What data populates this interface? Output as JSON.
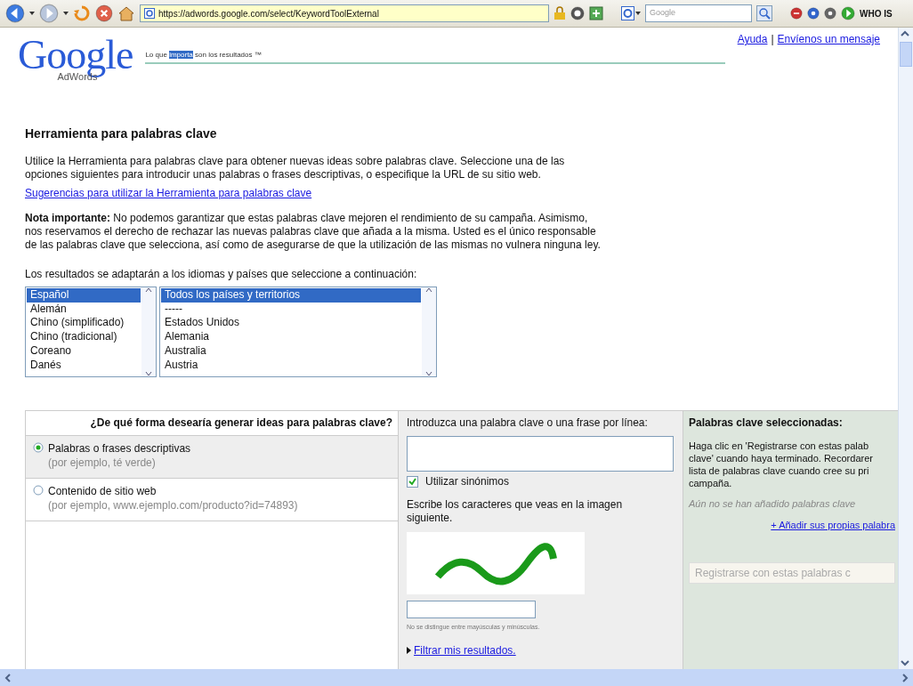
{
  "browser": {
    "url": "https://adwords.google.com/select/KeywordToolExternal",
    "search_placeholder": "Google",
    "whois": "WHO IS"
  },
  "header": {
    "logo": "Google",
    "logo_sub": "AdWords",
    "tagline": {
      "before": "Lo que ",
      "selected_text": "importa",
      "after": " son los resultados ™"
    },
    "links": [
      "Ayuda",
      "Envíenos un mensaje"
    ],
    "separator": "|"
  },
  "title": "Herramienta para palabras clave",
  "intro": "Utilice la Herramienta para palabras clave para obtener nuevas ideas sobre palabras clave. Seleccione una de las opciones siguientes para introducir unas palabras o frases descriptivas, o especifique la URL de su sitio web.",
  "tips_link": "Sugerencias para utilizar la Herramienta para palabras clave",
  "note": "**Nota importante:** No podemos garantizar que estas palabras clave mejoren el rendimiento de su campaña. Asimismo, nos reservamos el derecho de rechazar las nuevas palabras clave que añada a la misma. Usted es el único responsable de las palabras clave que selecciona, así como de asegurarse de que la utilización de las mismas no vulnera ninguna ley.",
  "lists_label": "Los resultados se adaptarán a los idiomas y países que seleccione a continuación:",
  "languages": [
    {
      "label": "Español",
      "selected": true
    },
    {
      "label": "Alemán",
      "selected": false
    },
    {
      "label": "Chino (simplificado)",
      "selected": false
    },
    {
      "label": "Chino (tradicional)",
      "selected": false
    },
    {
      "label": "Coreano",
      "selected": false
    },
    {
      "label": "Danés",
      "selected": false
    }
  ],
  "countries": [
    {
      "label": "Todos los países y territorios",
      "selected": true
    },
    {
      "label": "-----",
      "selected": false
    },
    {
      "label": "Estados Unidos",
      "selected": false
    },
    {
      "label": "Alemania",
      "selected": false
    },
    {
      "label": "Australia",
      "selected": false
    },
    {
      "label": "Austria",
      "selected": false
    }
  ],
  "method": {
    "heading": "¿De qué forma desearía generar ideas para palabras clave?",
    "options": [
      {
        "label": "Palabras o frases descriptivas",
        "example": "(por ejemplo, té verde)",
        "selected": true
      },
      {
        "label": "Contenido de sitio web",
        "example": "(por ejemplo, www.ejemplo.com/producto?id=74893)",
        "selected": false
      }
    ]
  },
  "entry": {
    "label": "Introduzca una palabra clave o una frase por línea:",
    "synonyms": {
      "label": "Utilizar sinónimos",
      "checked": true
    },
    "captcha_prompt": "Escribe los caracteres que veas en la imagen siguiente.",
    "captcha_hint": "No se distingue entre mayúsculas y minúsculas.",
    "filter_link": "Filtrar mis resultados."
  },
  "selected_keywords": {
    "heading": "Palabras clave seleccionadas:",
    "instructions": [
      "Haga clic en 'Registrarse con estas palab",
      "clave' cuando haya terminado. Recordarer",
      "lista de palabras clave cuando cree su pri",
      "campaña."
    ],
    "empty_note": "Aún no se han añadido palabras clave",
    "add_link": "+ Añadir sus propias palabra",
    "register_button": "Registrarse con estas palabras c"
  }
}
